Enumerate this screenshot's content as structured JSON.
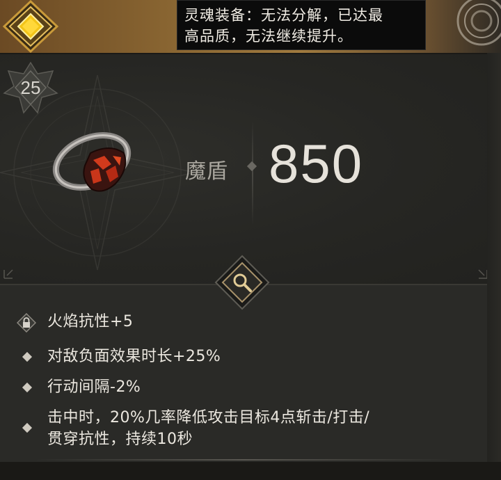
{
  "tooltip": {
    "line1": "灵魂装备：无法分解，已达最",
    "line2": "高品质，无法继续提升。"
  },
  "item": {
    "level": "25",
    "icon": "molten-ring-icon",
    "stat_label": "魔盾",
    "stat_value": "850"
  },
  "affixes": [
    {
      "icon": "lock-icon",
      "lines": [
        "火焰抗性+5"
      ]
    },
    {
      "icon": "diamond-bullet-icon",
      "lines": [
        "对敌负面效果时长+25%"
      ]
    },
    {
      "icon": "diamond-bullet-icon",
      "lines": [
        "行动间隔-2%"
      ]
    },
    {
      "icon": "diamond-bullet-icon",
      "lines": [
        "击中时，20%几率降低攻击目标4点斩击/打击/",
        "贯穿抗性，持续10秒"
      ]
    }
  ],
  "colors": {
    "gold": "#e8b830",
    "panel": "#252623",
    "text": "#ece8e0",
    "muted": "#a9a69e"
  }
}
